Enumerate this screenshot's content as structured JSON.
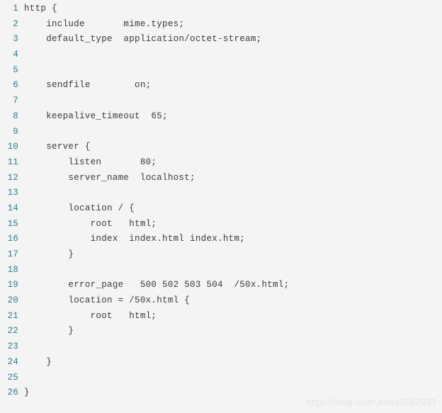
{
  "editor": {
    "language": "nginx",
    "background_color": "#f4f4f4",
    "line_number_color": "#2d7d8f",
    "code_text_color": "#3a3a3a",
    "total_lines": 26,
    "lines": [
      {
        "number": "1",
        "text": "http {"
      },
      {
        "number": "2",
        "text": "    include       mime.types;"
      },
      {
        "number": "3",
        "text": "    default_type  application/octet-stream;"
      },
      {
        "number": "4",
        "text": ""
      },
      {
        "number": "5",
        "text": ""
      },
      {
        "number": "6",
        "text": "    sendfile        on;"
      },
      {
        "number": "7",
        "text": ""
      },
      {
        "number": "8",
        "text": "    keepalive_timeout  65;"
      },
      {
        "number": "9",
        "text": ""
      },
      {
        "number": "10",
        "text": "    server {"
      },
      {
        "number": "11",
        "text": "        listen       80;"
      },
      {
        "number": "12",
        "text": "        server_name  localhost;"
      },
      {
        "number": "13",
        "text": ""
      },
      {
        "number": "14",
        "text": "        location / {"
      },
      {
        "number": "15",
        "text": "            root   html;"
      },
      {
        "number": "16",
        "text": "            index  index.html index.htm;"
      },
      {
        "number": "17",
        "text": "        }"
      },
      {
        "number": "18",
        "text": ""
      },
      {
        "number": "19",
        "text": "        error_page   500 502 503 504  /50x.html;"
      },
      {
        "number": "20",
        "text": "        location = /50x.html {"
      },
      {
        "number": "21",
        "text": "            root   html;"
      },
      {
        "number": "22",
        "text": "        }"
      },
      {
        "number": "23",
        "text": ""
      },
      {
        "number": "24",
        "text": "    }"
      },
      {
        "number": "25",
        "text": ""
      },
      {
        "number": "26",
        "text": "}"
      }
    ]
  },
  "watermark": {
    "text": "https://blog.csdn.net/a3562323"
  }
}
